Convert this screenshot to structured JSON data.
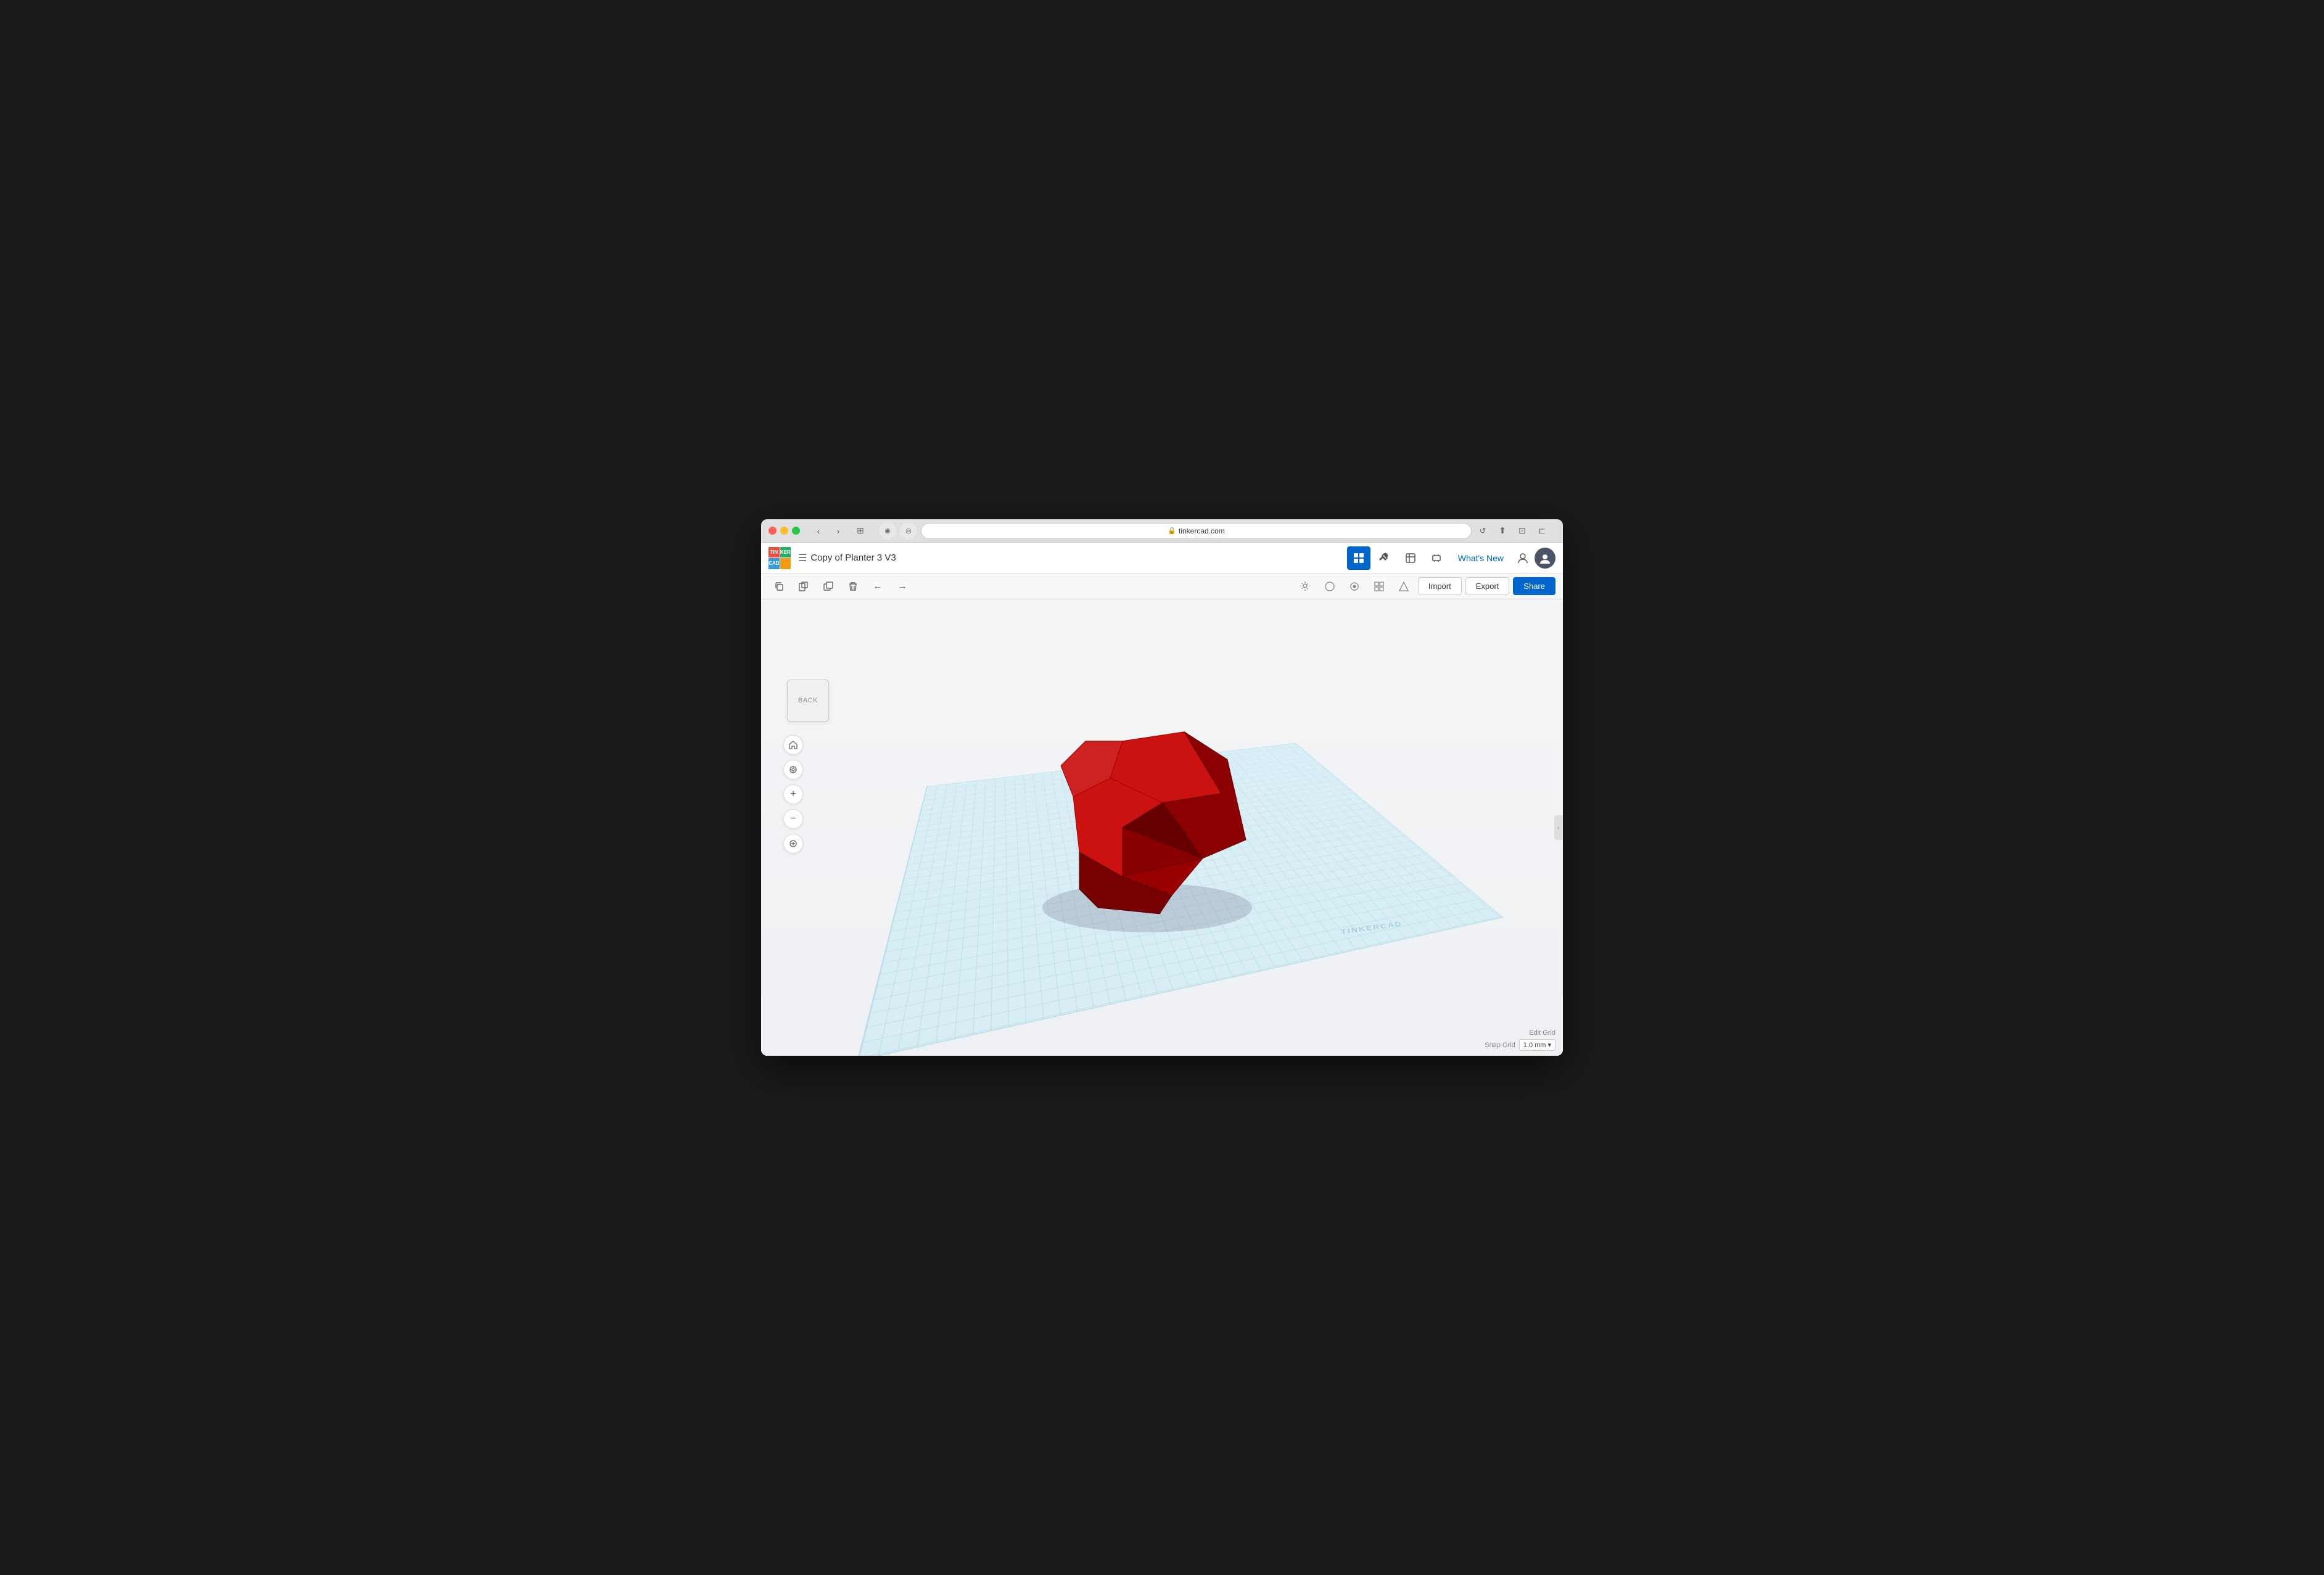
{
  "browser": {
    "url": "tinkercad.com",
    "tab_title": "tinkercad.com"
  },
  "toolbar": {
    "logo_letters": [
      "TIN",
      "KER",
      "CAD",
      ""
    ],
    "design_title": "Copy of Planter 3 V3",
    "whats_new": "What's New",
    "import_label": "Import",
    "export_label": "Export",
    "share_label": "Share"
  },
  "view_controls": {
    "back_label": "BACK"
  },
  "bottom": {
    "edit_grid": "Edit Grid",
    "snap_grid": "Snap Grid",
    "snap_value": "1.0 mm"
  },
  "nav_controls": [
    {
      "icon": "⊙",
      "label": "home"
    },
    {
      "icon": "↻",
      "label": "rotate"
    },
    {
      "icon": "+",
      "label": "zoom-in"
    },
    {
      "icon": "−",
      "label": "zoom-out"
    },
    {
      "icon": "⊕",
      "label": "fit"
    }
  ],
  "edit_tools": [
    {
      "icon": "⧉",
      "label": "copy"
    },
    {
      "icon": "❐",
      "label": "paste"
    },
    {
      "icon": "⧈",
      "label": "duplicate"
    },
    {
      "icon": "🗑",
      "label": "delete"
    },
    {
      "icon": "←",
      "label": "undo"
    },
    {
      "icon": "→",
      "label": "redo"
    }
  ],
  "shape_tools": [
    {
      "icon": "💡",
      "label": "light"
    },
    {
      "icon": "⬡",
      "label": "shape1"
    },
    {
      "icon": "⬤",
      "label": "shape2"
    },
    {
      "icon": "⊞",
      "label": "shape3"
    },
    {
      "icon": "⊿",
      "label": "shape4"
    }
  ]
}
